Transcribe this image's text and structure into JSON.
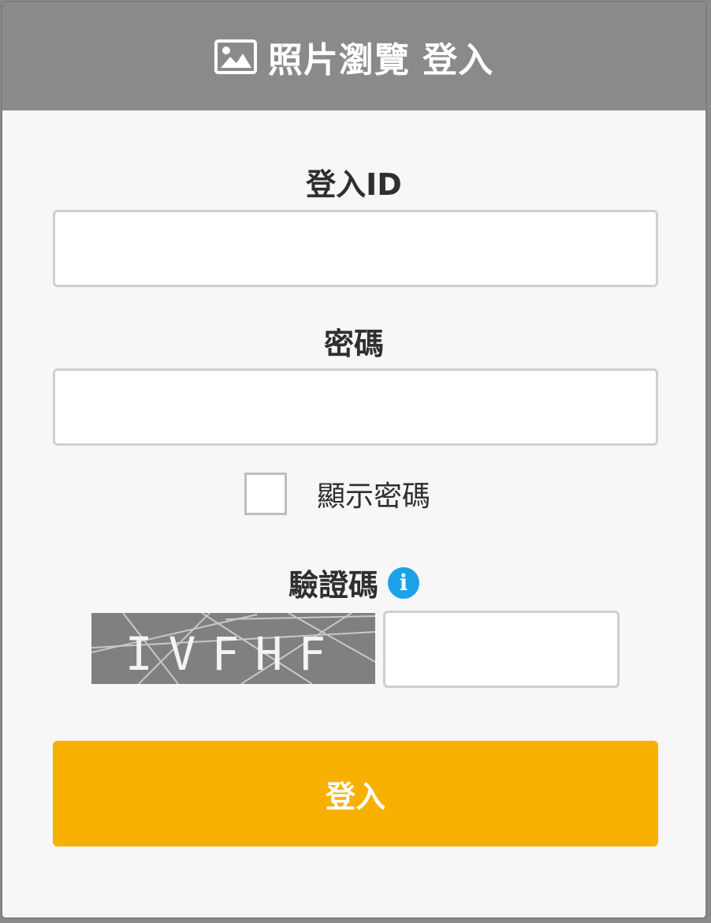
{
  "header": {
    "title": "照片瀏覽 登入",
    "icon": "image-icon"
  },
  "login_id": {
    "label": "登入ID",
    "value": "",
    "placeholder": ""
  },
  "password": {
    "label": "密碼",
    "value": "",
    "placeholder": ""
  },
  "show_password": {
    "label": "顯示密碼",
    "checked": false
  },
  "captcha": {
    "label": "驗證碼",
    "info_icon": "info-icon",
    "image_text": "IVFHF",
    "value": "",
    "placeholder": ""
  },
  "login_button": {
    "label": "登入"
  },
  "colors": {
    "header_bg": "#8a8a8a",
    "button_bg": "#f8b000",
    "info_icon": "#1ba2e8",
    "captcha_bg": "#808080"
  }
}
